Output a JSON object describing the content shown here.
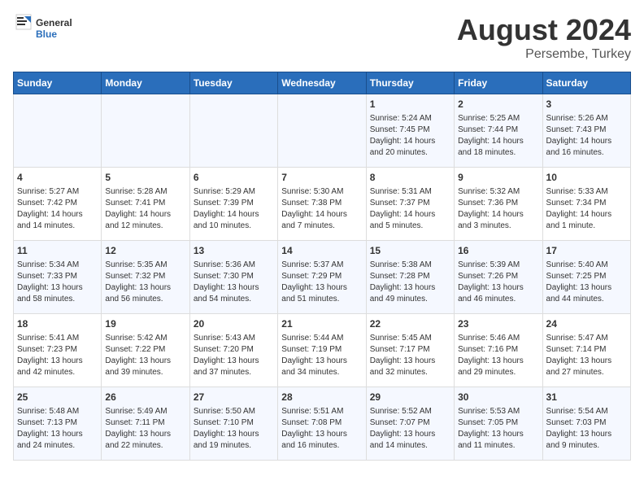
{
  "header": {
    "logo_general": "General",
    "logo_blue": "Blue",
    "main_title": "August 2024",
    "subtitle": "Persembe, Turkey"
  },
  "days_of_week": [
    "Sunday",
    "Monday",
    "Tuesday",
    "Wednesday",
    "Thursday",
    "Friday",
    "Saturday"
  ],
  "weeks": [
    [
      {
        "day": "",
        "content": ""
      },
      {
        "day": "",
        "content": ""
      },
      {
        "day": "",
        "content": ""
      },
      {
        "day": "",
        "content": ""
      },
      {
        "day": "1",
        "content": "Sunrise: 5:24 AM\nSunset: 7:45 PM\nDaylight: 14 hours\nand 20 minutes."
      },
      {
        "day": "2",
        "content": "Sunrise: 5:25 AM\nSunset: 7:44 PM\nDaylight: 14 hours\nand 18 minutes."
      },
      {
        "day": "3",
        "content": "Sunrise: 5:26 AM\nSunset: 7:43 PM\nDaylight: 14 hours\nand 16 minutes."
      }
    ],
    [
      {
        "day": "4",
        "content": "Sunrise: 5:27 AM\nSunset: 7:42 PM\nDaylight: 14 hours\nand 14 minutes."
      },
      {
        "day": "5",
        "content": "Sunrise: 5:28 AM\nSunset: 7:41 PM\nDaylight: 14 hours\nand 12 minutes."
      },
      {
        "day": "6",
        "content": "Sunrise: 5:29 AM\nSunset: 7:39 PM\nDaylight: 14 hours\nand 10 minutes."
      },
      {
        "day": "7",
        "content": "Sunrise: 5:30 AM\nSunset: 7:38 PM\nDaylight: 14 hours\nand 7 minutes."
      },
      {
        "day": "8",
        "content": "Sunrise: 5:31 AM\nSunset: 7:37 PM\nDaylight: 14 hours\nand 5 minutes."
      },
      {
        "day": "9",
        "content": "Sunrise: 5:32 AM\nSunset: 7:36 PM\nDaylight: 14 hours\nand 3 minutes."
      },
      {
        "day": "10",
        "content": "Sunrise: 5:33 AM\nSunset: 7:34 PM\nDaylight: 14 hours\nand 1 minute."
      }
    ],
    [
      {
        "day": "11",
        "content": "Sunrise: 5:34 AM\nSunset: 7:33 PM\nDaylight: 13 hours\nand 58 minutes."
      },
      {
        "day": "12",
        "content": "Sunrise: 5:35 AM\nSunset: 7:32 PM\nDaylight: 13 hours\nand 56 minutes."
      },
      {
        "day": "13",
        "content": "Sunrise: 5:36 AM\nSunset: 7:30 PM\nDaylight: 13 hours\nand 54 minutes."
      },
      {
        "day": "14",
        "content": "Sunrise: 5:37 AM\nSunset: 7:29 PM\nDaylight: 13 hours\nand 51 minutes."
      },
      {
        "day": "15",
        "content": "Sunrise: 5:38 AM\nSunset: 7:28 PM\nDaylight: 13 hours\nand 49 minutes."
      },
      {
        "day": "16",
        "content": "Sunrise: 5:39 AM\nSunset: 7:26 PM\nDaylight: 13 hours\nand 46 minutes."
      },
      {
        "day": "17",
        "content": "Sunrise: 5:40 AM\nSunset: 7:25 PM\nDaylight: 13 hours\nand 44 minutes."
      }
    ],
    [
      {
        "day": "18",
        "content": "Sunrise: 5:41 AM\nSunset: 7:23 PM\nDaylight: 13 hours\nand 42 minutes."
      },
      {
        "day": "19",
        "content": "Sunrise: 5:42 AM\nSunset: 7:22 PM\nDaylight: 13 hours\nand 39 minutes."
      },
      {
        "day": "20",
        "content": "Sunrise: 5:43 AM\nSunset: 7:20 PM\nDaylight: 13 hours\nand 37 minutes."
      },
      {
        "day": "21",
        "content": "Sunrise: 5:44 AM\nSunset: 7:19 PM\nDaylight: 13 hours\nand 34 minutes."
      },
      {
        "day": "22",
        "content": "Sunrise: 5:45 AM\nSunset: 7:17 PM\nDaylight: 13 hours\nand 32 minutes."
      },
      {
        "day": "23",
        "content": "Sunrise: 5:46 AM\nSunset: 7:16 PM\nDaylight: 13 hours\nand 29 minutes."
      },
      {
        "day": "24",
        "content": "Sunrise: 5:47 AM\nSunset: 7:14 PM\nDaylight: 13 hours\nand 27 minutes."
      }
    ],
    [
      {
        "day": "25",
        "content": "Sunrise: 5:48 AM\nSunset: 7:13 PM\nDaylight: 13 hours\nand 24 minutes."
      },
      {
        "day": "26",
        "content": "Sunrise: 5:49 AM\nSunset: 7:11 PM\nDaylight: 13 hours\nand 22 minutes."
      },
      {
        "day": "27",
        "content": "Sunrise: 5:50 AM\nSunset: 7:10 PM\nDaylight: 13 hours\nand 19 minutes."
      },
      {
        "day": "28",
        "content": "Sunrise: 5:51 AM\nSunset: 7:08 PM\nDaylight: 13 hours\nand 16 minutes."
      },
      {
        "day": "29",
        "content": "Sunrise: 5:52 AM\nSunset: 7:07 PM\nDaylight: 13 hours\nand 14 minutes."
      },
      {
        "day": "30",
        "content": "Sunrise: 5:53 AM\nSunset: 7:05 PM\nDaylight: 13 hours\nand 11 minutes."
      },
      {
        "day": "31",
        "content": "Sunrise: 5:54 AM\nSunset: 7:03 PM\nDaylight: 13 hours\nand 9 minutes."
      }
    ]
  ]
}
